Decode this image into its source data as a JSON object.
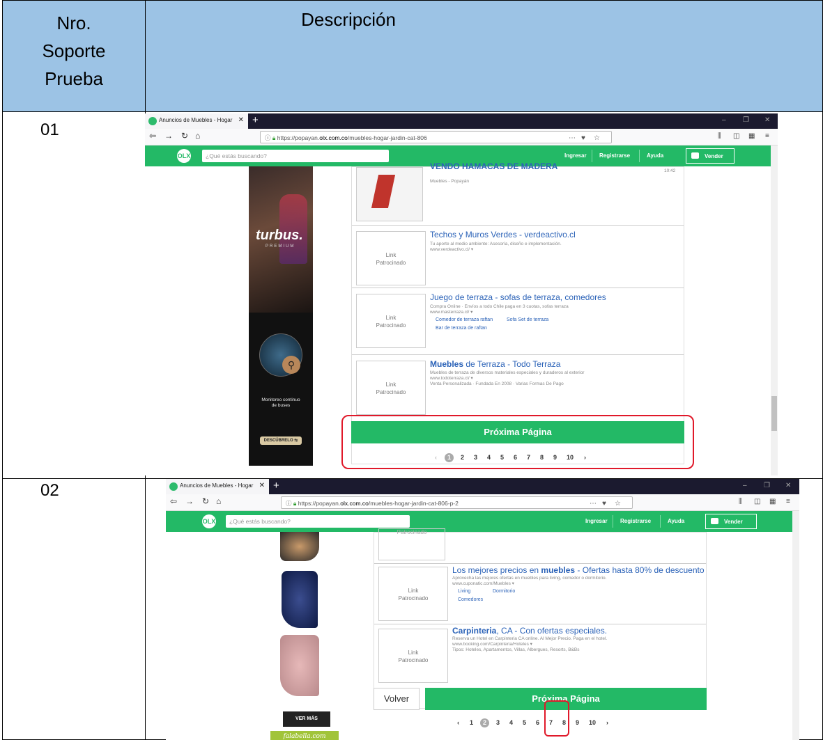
{
  "header": {
    "nro_line1": "Nro.",
    "nro_line2": "Soporte",
    "nro_line3": "Prueba",
    "descripcion": "Descripción"
  },
  "rows": [
    {
      "nro": "01",
      "tab_title": "Anuncios de Muebles - Hogar",
      "url_prefix": "https://popayan.",
      "url_domain": "olx.com.co",
      "url_suffix": "/muebles-hogar-jardin-cat-806",
      "search_placeholder": "¿Qué estás buscando?",
      "nav": {
        "ingresar": "Ingresar",
        "registrarse": "Registrarse",
        "ayuda": "Ayuda",
        "vender": "Vender"
      },
      "ad": {
        "brand": "turbus.",
        "brand_sub": "PREMIUM",
        "caption1": "Monitoreo continuo",
        "caption2": "de buses",
        "cta": "DESCÚBRELO ⇆"
      },
      "listing0": {
        "title": "VENDO HAMACAS DE MADERA",
        "sub": "Muebles - Popayán",
        "time": "10:42"
      },
      "cards": [
        {
          "thumb1": "Link",
          "thumb2": "Patrocinado",
          "title": "Techos y Muros Verdes - verdeactivo.cl",
          "sub1": "Tu aporte al medio ambiente: Asesoría, diseño e implementación.",
          "sub2": "www.verdeactivo.cl/ ▾"
        },
        {
          "thumb1": "Link",
          "thumb2": "Patrocinado",
          "title": "Juego de terraza - sofas de terraza, comedores",
          "sub1": "Compra Online · Envíos a todo Chile paga en 3 cuotas, sofas terraza",
          "sub2": "www.masterraza.cl/ ▾",
          "link1": "Comedor de terraza raftan",
          "link2": "Sofa Set de terraza",
          "link3": "Bar de terraza de raftan"
        },
        {
          "thumb1": "Link",
          "thumb2": "Patrocinado",
          "title_bold": "Muebles",
          "title_rest": " de Terraza - Todo Terraza",
          "sub0": "Muebles de terraza de diversos materiales especiales y duraderos al exterior",
          "sub1": "www.todoterraza.cl/ ▾",
          "sub2": "Venta Personalizada · Fundada En 2008 · Varias Formas De Pago"
        }
      ],
      "next_button": "Próxima Página",
      "pages": [
        "1",
        "2",
        "3",
        "4",
        "5",
        "6",
        "7",
        "8",
        "9",
        "10"
      ],
      "current_page": "1"
    },
    {
      "nro": "02",
      "tab_title": "Anuncios de Muebles - Hogar",
      "url_prefix": "https://popayan.",
      "url_domain": "olx.com.co",
      "url_suffix": "/muebles-hogar-jardin-cat-806-p-2",
      "search_placeholder": "¿Qué estás buscando?",
      "nav": {
        "ingresar": "Ingresar",
        "registrarse": "Registrarse",
        "ayuda": "Ayuda",
        "vender": "Vender"
      },
      "ad": {
        "cta": "VER MÁS",
        "brand": "falabella.com"
      },
      "partial_thumb": "Patrocinado",
      "cards": [
        {
          "thumb1": "Link",
          "thumb2": "Patrocinado",
          "title_a": "Los mejores precios en ",
          "title_bold": "muebles",
          "title_b": " - Ofertas hasta 80% de descuento",
          "sub1": "Aprovecha las mejores ofertas en muebles para living, comedor o dormitorio.",
          "sub2": "www.cuponatic.com/Muebles ▾",
          "link1": "Living",
          "link2": "Dormitorio",
          "link3": "Comedores"
        },
        {
          "thumb1": "Link",
          "thumb2": "Patrocinado",
          "title_bold": "Carpinteria",
          "title_rest": ", CA - Con ofertas especiales.",
          "sub1": "Reserva un Hotel en Carpinteria CA online. Al Mejor Precio. Paga en el hotel.",
          "sub2": "www.booking.com/Carpinteria/Hoteles ▾",
          "sub3": "Tipos: Hoteles, Apartamentos, Villas, Albergues, Resorts, B&Bs"
        }
      ],
      "back_button": "Volver",
      "next_button": "Próxima Página",
      "pages": [
        "1",
        "2",
        "3",
        "4",
        "5",
        "6",
        "7",
        "8",
        "9",
        "10"
      ],
      "current_page": "2"
    }
  ]
}
